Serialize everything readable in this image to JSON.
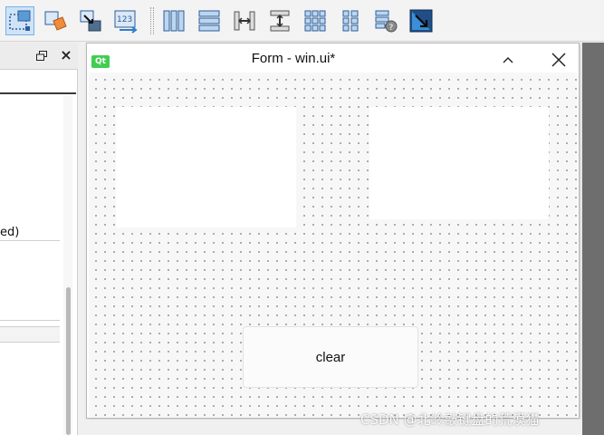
{
  "toolbar": {
    "buttons": [
      {
        "name": "edit-widgets-icon",
        "active": true
      },
      {
        "name": "edit-signals-slots-icon"
      },
      {
        "name": "edit-buddies-icon"
      },
      {
        "name": "edit-tab-order-icon",
        "label": "123"
      },
      {
        "name": "layout-horizontal-icon"
      },
      {
        "name": "layout-vertical-icon"
      },
      {
        "name": "layout-horizontal-splitter-icon"
      },
      {
        "name": "layout-vertical-splitter-icon"
      },
      {
        "name": "layout-grid-icon"
      },
      {
        "name": "layout-form-icon"
      },
      {
        "name": "break-layout-icon"
      },
      {
        "name": "adjust-size-icon"
      }
    ]
  },
  "left_dock": {
    "clipped_text": "ed)"
  },
  "form": {
    "logo_text": "Qt",
    "title": "Form - win.ui*",
    "button_label": "clear"
  },
  "watermark": "CSDN @北岭敲键盘的荒漠猫",
  "colors": {
    "toolbar_icon_blue": "#2d7fc6",
    "active_button_bg": "#cfe3f7",
    "qt_green": "#41cd52",
    "canvas_bg": "#f7f7f7"
  }
}
